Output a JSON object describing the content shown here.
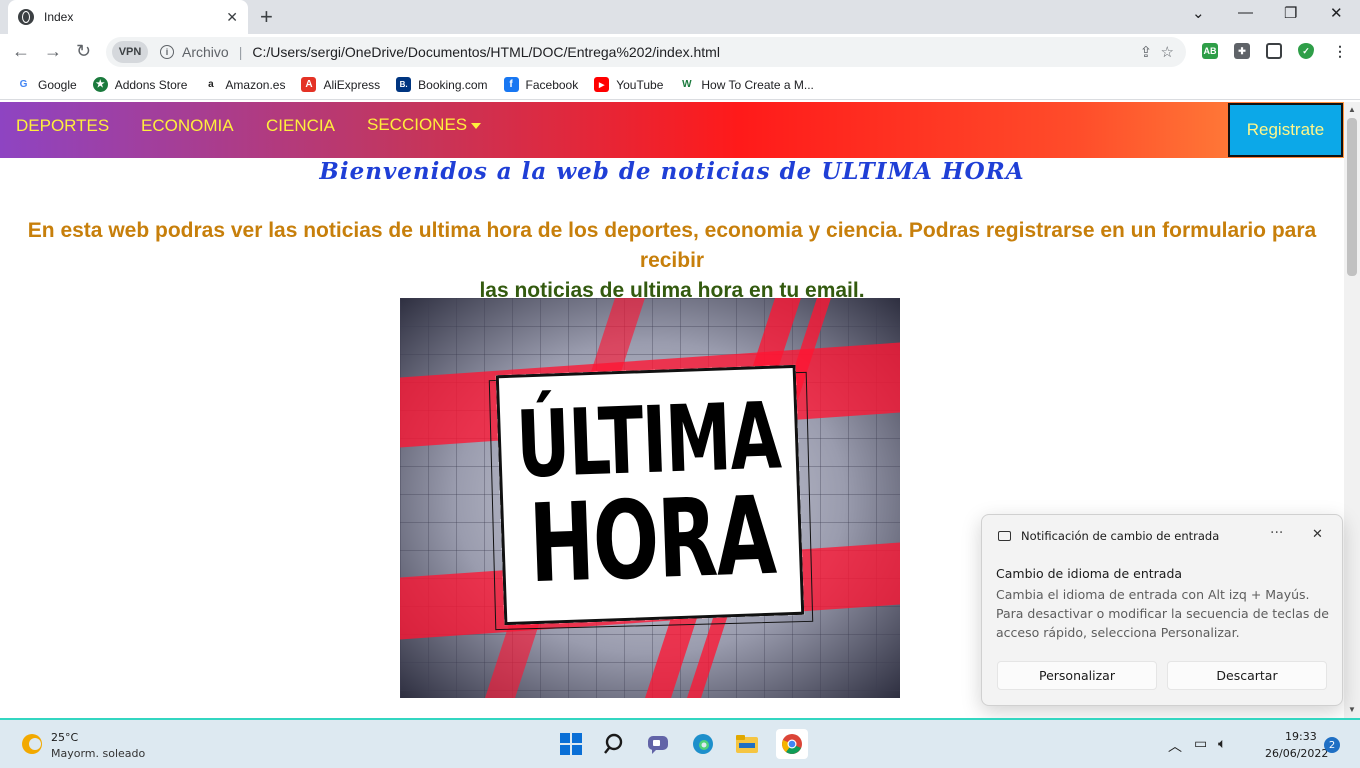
{
  "browser": {
    "tab_title": "Index",
    "new_tab": "+",
    "vpn_label": "VPN",
    "scheme_label": "Archivo",
    "url": "C:/Users/sergi/OneDrive/Documentos/HTML/DOC/Entrega%202/index.html",
    "extensions": [
      {
        "name": "adblock",
        "label": "AB",
        "color": "#2e9e48"
      },
      {
        "name": "puzzle",
        "label": "",
        "color": "#5f6368"
      },
      {
        "name": "sidepanel",
        "label": "",
        "color": "#5f6368"
      },
      {
        "name": "shield",
        "label": "",
        "color": "#2e9e48"
      }
    ]
  },
  "bookmarks": [
    {
      "label": "Google",
      "icon": "G",
      "color": "#4285f4"
    },
    {
      "label": "Addons Store",
      "icon": "★",
      "color": "#1b7a3d"
    },
    {
      "label": "Amazon.es",
      "icon": "a",
      "color": "#222222"
    },
    {
      "label": "AliExpress",
      "icon": "A",
      "color": "#e43225"
    },
    {
      "label": "Booking.com",
      "icon": "B.",
      "color": "#003580"
    },
    {
      "label": "Facebook",
      "icon": "f",
      "color": "#1877f2"
    },
    {
      "label": "YouTube",
      "icon": "▶",
      "color": "#ff0000"
    },
    {
      "label": "How To Create a M...",
      "icon": "W",
      "color": "#1b7a3d"
    }
  ],
  "site": {
    "nav": {
      "deportes": "DEPORTES",
      "economia": "ECONOMIA",
      "ciencia": "CIENCIA",
      "secciones": "SECCIONES",
      "register": "Registrate"
    },
    "welcome": "Bienvenidos a la web de noticias de ULTIMA HORA",
    "intro_line1": "En esta web podras ver las noticias de ultima hora de los deportes, economia y ciencia. Podras registrarse en un formulario para recibir",
    "intro_line2": "las noticias de ultima hora en tu email.",
    "hero": {
      "line1": "ÚLTIMA",
      "line2": "HORA"
    }
  },
  "toast": {
    "header": "Notificación de cambio de entrada",
    "more": "···",
    "title": "Cambio de idioma de entrada",
    "body": "Cambia el idioma de entrada con Alt izq + Mayús. Para desactivar o modificar la secuencia de teclas de acceso rápido, selecciona Personalizar.",
    "btn_customize": "Personalizar",
    "btn_dismiss": "Descartar"
  },
  "taskbar": {
    "temperature": "25°C",
    "condition": "Mayorm. soleado",
    "time": "19:33",
    "date": "26/06/2022",
    "notifications": "2"
  }
}
